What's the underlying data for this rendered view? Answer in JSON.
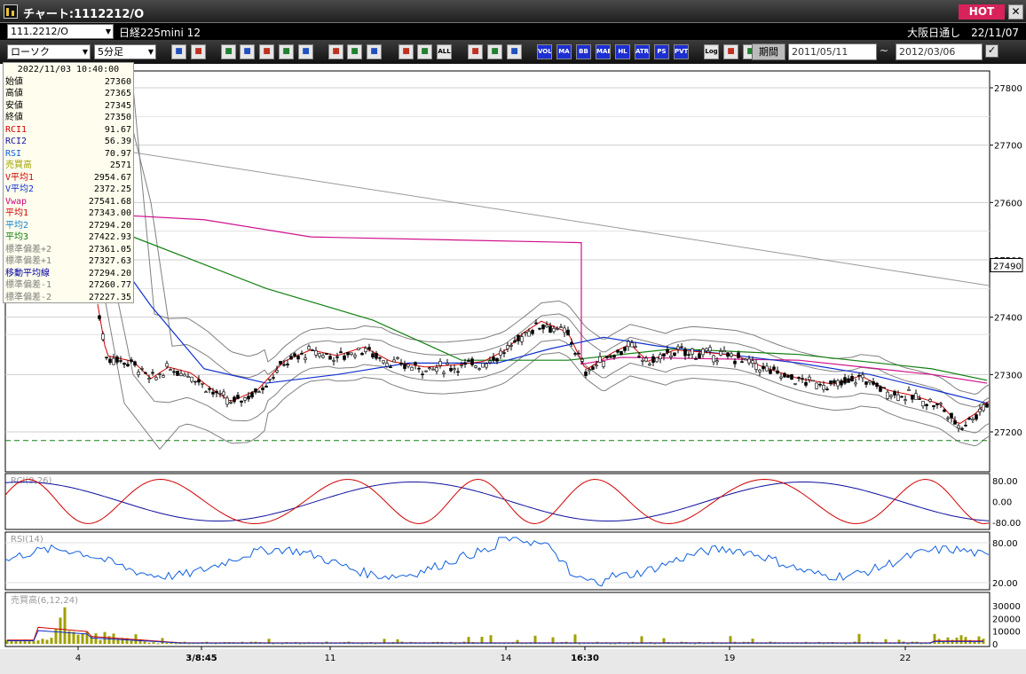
{
  "window": {
    "title": "チャート:1112212/O",
    "hot": "HOT",
    "close": "✕"
  },
  "toolbar": {
    "symbol_code": "111.2212/O",
    "symbol_name": "日経225mini 12",
    "market_info": "大阪日通し　22/11/07",
    "chart_type": "ローソク",
    "interval": "5分足",
    "period_label": "期間",
    "date_from": "2011/05/11",
    "date_to": "2012/03/06",
    "tilde": "~",
    "buttons": [
      "zoom-icon",
      "grid-icon",
      "cross-icon",
      "search-icon",
      "bars-icon",
      "arrows-icon",
      "warn-icon",
      "pencil-icon",
      "cursor-icon",
      "undo-icon",
      "candle1-icon",
      "candle2-icon",
      "ALL",
      "gear-icon",
      "brush-icon",
      "palette-icon",
      "VOL",
      "MA",
      "BB",
      "MAE",
      "HL",
      "ATR",
      "PS",
      "PVT",
      "Log",
      "screen-icon",
      "save-icon"
    ]
  },
  "info": {
    "datetime": "2022/11/03  10:40:00",
    "rows": [
      {
        "label": "始値",
        "value": "27360",
        "color": "#000000"
      },
      {
        "label": "高値",
        "value": "27365",
        "color": "#000000"
      },
      {
        "label": "安値",
        "value": "27345",
        "color": "#000000"
      },
      {
        "label": "終値",
        "value": "27350",
        "color": "#000000"
      },
      {
        "label": "RCI1",
        "value": "91.67",
        "color": "#d00000"
      },
      {
        "label": "RCI2",
        "value": "56.39",
        "color": "#1010a0"
      },
      {
        "label": "RSI",
        "value": "70.97",
        "color": "#1060e0"
      },
      {
        "label": "売買高",
        "value": "2571",
        "color": "#a0a000"
      },
      {
        "label": "V平均1",
        "value": "2954.67",
        "color": "#d00000"
      },
      {
        "label": "V平均2",
        "value": "2372.25",
        "color": "#1030d0"
      },
      {
        "label": "Vwap",
        "value": "27541.68",
        "color": "#d00080"
      },
      {
        "label": "平均1",
        "value": "27343.00",
        "color": "#d00000"
      },
      {
        "label": "平均2",
        "value": "27294.20",
        "color": "#1080d0"
      },
      {
        "label": "平均3",
        "value": "27422.93",
        "color": "#108010"
      },
      {
        "label": "標準偏差+2",
        "value": "27361.05",
        "color": "#808080"
      },
      {
        "label": "標準偏差+1",
        "value": "27327.63",
        "color": "#808080"
      },
      {
        "label": "移動平均線",
        "value": "27294.20",
        "color": "#0000a0"
      },
      {
        "label": "標準偏差-1",
        "value": "27260.77",
        "color": "#808080"
      },
      {
        "label": "標準偏差-2",
        "value": "27227.35",
        "color": "#808080"
      }
    ]
  },
  "chart_data": {
    "type": "candlestick",
    "price_ticks": [
      "27800",
      "27700",
      "27600",
      "27500",
      "27400",
      "27300",
      "27200"
    ],
    "current_price": "27490",
    "x_ticks": [
      "4",
      "3/8:45",
      "11",
      "14",
      "16:30",
      "19",
      "22"
    ],
    "rci_label": "RCI(9,26)",
    "rci_ticks": [
      "80.00",
      "0.00",
      "-80.00"
    ],
    "rsi_label": "RSI(14)",
    "rsi_ticks": [
      "80.00",
      "20.00"
    ],
    "vol_label": "売買高(6,12,24)",
    "vol_ticks": [
      "30000",
      "20000",
      "10000",
      "0"
    ],
    "colors": {
      "ma1": "#d00000",
      "ma2": "#1030d0",
      "ma3": "#108010",
      "vwap": "#d0108a",
      "band": "#808080",
      "rci1": "#d00000",
      "rci2": "#1010a0",
      "rsi": "#1060e0",
      "vol": "#a0a000"
    }
  }
}
